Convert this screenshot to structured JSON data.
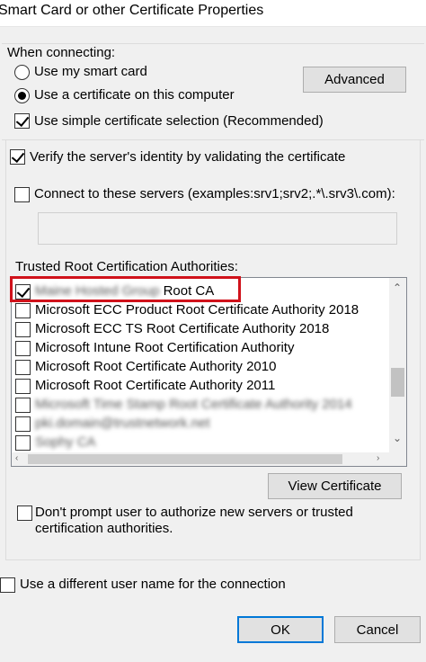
{
  "window": {
    "title": "Smart Card or other Certificate Properties"
  },
  "when_connecting": {
    "label": "When connecting:",
    "use_smart_card": "Use my smart card",
    "use_certificate": "Use a certificate on this computer",
    "simple_selection": "Use simple certificate selection (Recommended)",
    "advanced_button": "Advanced"
  },
  "verify": {
    "label": "Verify the server's identity by validating the certificate",
    "connect_to_servers": "Connect to these servers (examples:srv1;srv2;.*\\.srv3\\.com):",
    "servers_value": ""
  },
  "trusted_root": {
    "label": "Trusted Root Certification Authorities:",
    "items": [
      {
        "label_hidden": "Maine Hosted Group",
        "label": "Root CA",
        "checked": true
      },
      {
        "label": "Microsoft ECC Product Root Certificate Authority 2018",
        "checked": false
      },
      {
        "label": "Microsoft ECC TS Root Certificate Authority 2018",
        "checked": false
      },
      {
        "label": "Microsoft Intune Root Certification Authority",
        "checked": false
      },
      {
        "label": "Microsoft Root Certificate Authority 2010",
        "checked": false
      },
      {
        "label": "Microsoft Root Certificate Authority 2011",
        "checked": false
      },
      {
        "label": "Microsoft Time Stamp Root Certificate Authority 2014",
        "checked": false
      },
      {
        "label": "pki.domain@trustnetwork.net",
        "checked": false
      },
      {
        "label": "Sophy CA",
        "checked": false
      }
    ]
  },
  "view_certificate_button": "View Certificate",
  "dont_prompt": "Don't prompt user to authorize new servers or trusted certification authorities.",
  "different_user": "Use a different user name for the connection",
  "ok_button": "OK",
  "cancel_button": "Cancel"
}
